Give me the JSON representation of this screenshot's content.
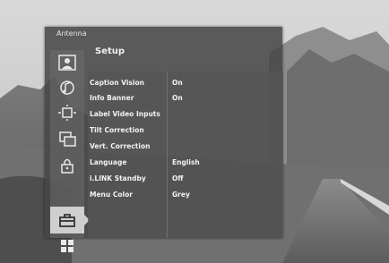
{
  "menu": {
    "category": "Antenna",
    "heading": "Setup",
    "selected_icon": "toolbox-icon"
  },
  "sidebar": {
    "icons": [
      "picture-icon",
      "sound-icon",
      "screen-icon",
      "channel-icon",
      "lock-icon",
      "toolbox-icon",
      "apps-icon"
    ]
  },
  "settings": [
    {
      "label": "Caption Vision",
      "value": "On"
    },
    {
      "label": "Info Banner",
      "value": "On"
    },
    {
      "label": "Label Video Inputs",
      "value": ""
    },
    {
      "label": "Tilt Correction",
      "value": ""
    },
    {
      "label": "Vert. Correction",
      "value": ""
    },
    {
      "label": "Language",
      "value": "English"
    },
    {
      "label": "i.LINK Standby",
      "value": "Off"
    },
    {
      "label": "Menu Color",
      "value": "Grey"
    }
  ]
}
